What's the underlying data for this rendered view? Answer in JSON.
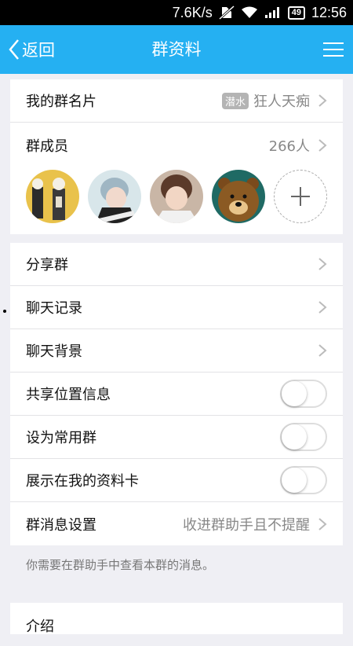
{
  "status_bar": {
    "network_speed": "7.6K/s",
    "battery": "49",
    "time": "12:56"
  },
  "header": {
    "back_label": "返回",
    "title": "群资料"
  },
  "group_card": {
    "label": "我的群名片",
    "tag": "潜水",
    "value": "狂人天痴"
  },
  "members": {
    "label": "群成员",
    "count": "266人"
  },
  "menu_items": [
    {
      "label": "分享群"
    },
    {
      "label": "聊天记录"
    },
    {
      "label": "聊天背景"
    }
  ],
  "toggles": [
    {
      "label": "共享位置信息",
      "on": false
    },
    {
      "label": "设为常用群",
      "on": false
    },
    {
      "label": "展示在我的资料卡",
      "on": false
    }
  ],
  "message_settings": {
    "label": "群消息设置",
    "value": "收进群助手且不提醒"
  },
  "hint": "你需要在群助手中查看本群的消息。",
  "intro": {
    "label": "介绍"
  },
  "colors": {
    "header": "#25b0f2",
    "background": "#efeff4"
  }
}
